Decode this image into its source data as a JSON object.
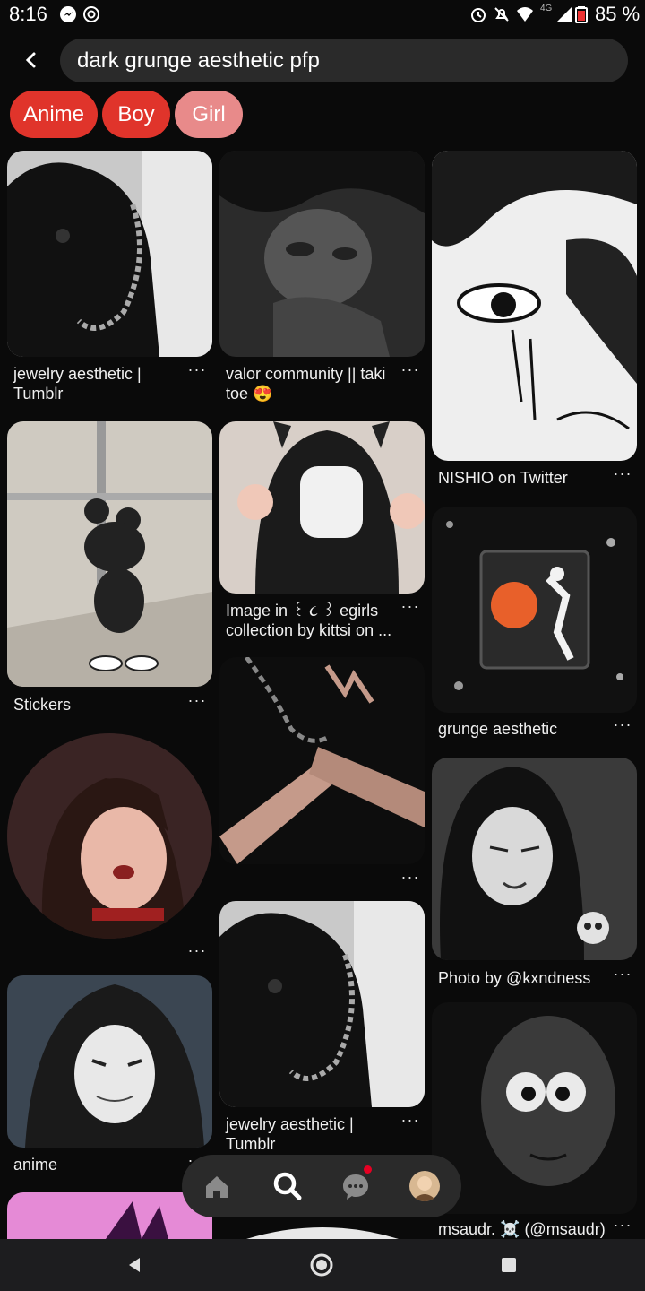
{
  "status_bar": {
    "time": "8:16",
    "battery_text": "85 %",
    "network": "4G"
  },
  "search": {
    "query": "dark grunge aesthetic pfp"
  },
  "chips": [
    {
      "label": "Anime",
      "color": "#e0342b"
    },
    {
      "label": "Boy",
      "color": "#e0342b"
    },
    {
      "label": "Girl",
      "color": "#e88a8a"
    }
  ],
  "pins": [
    {
      "caption": "jewelry aesthetic | Tumblr",
      "more": "···"
    },
    {
      "caption": "valor community || taki toe 😍",
      "more": "···"
    },
    {
      "caption": "NISHIO on Twitter",
      "more": "···"
    },
    {
      "caption": "Stickers",
      "more": "···"
    },
    {
      "caption": "Image in ꒰ ૮ ꒱ egirls collection by kittsi on ...",
      "more": "···"
    },
    {
      "caption": "grunge aesthetic",
      "more": "···"
    },
    {
      "caption": "",
      "more": "···"
    },
    {
      "caption": "",
      "more": "···"
    },
    {
      "caption": "Photo by @kxndness",
      "more": "···"
    },
    {
      "caption": "anime",
      "more": "···"
    },
    {
      "caption": "jewelry aesthetic | Tumblr",
      "more": "···"
    },
    {
      "caption": "msaudr. ☠️ (@msaudr)",
      "more": "···"
    }
  ],
  "bottom_nav": [
    "home-icon",
    "search-icon",
    "messages-icon",
    "profile-avatar"
  ],
  "colors": {
    "background": "#0a0a0a",
    "accent_red": "#e0342b",
    "notification_dot": "#e60023"
  }
}
